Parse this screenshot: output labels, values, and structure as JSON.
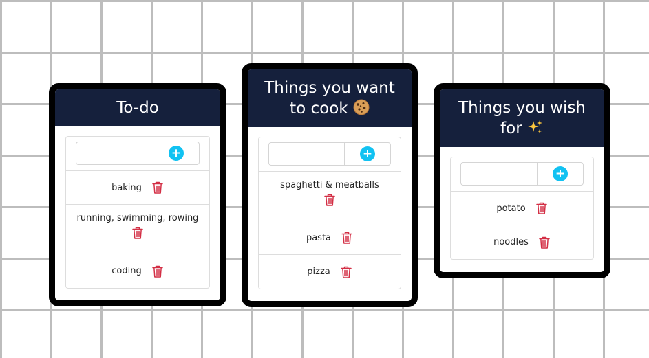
{
  "lists": [
    {
      "title": "To-do",
      "emoji": "",
      "input_value": "",
      "items": [
        "baking",
        "running, swimming, rowing",
        "coding"
      ]
    },
    {
      "title": "Things you want to cook",
      "emoji": "cookie",
      "input_value": "",
      "items": [
        "spaghetti & meatballs",
        "pasta",
        "pizza"
      ]
    },
    {
      "title": "Things you wish for",
      "emoji": "sparkles",
      "input_value": "",
      "items": [
        "potato",
        "noodles"
      ]
    }
  ],
  "icons": {
    "add": "plus-circle-icon",
    "delete": "trash-icon",
    "cookie": "cookie-icon",
    "sparkles": "sparkles-icon"
  },
  "colors": {
    "header_bg": "#15203c",
    "card_border": "#000000",
    "add_accent": "#12c2f2",
    "delete_red": "#d32f45",
    "grid_line": "#bdbdbd"
  }
}
